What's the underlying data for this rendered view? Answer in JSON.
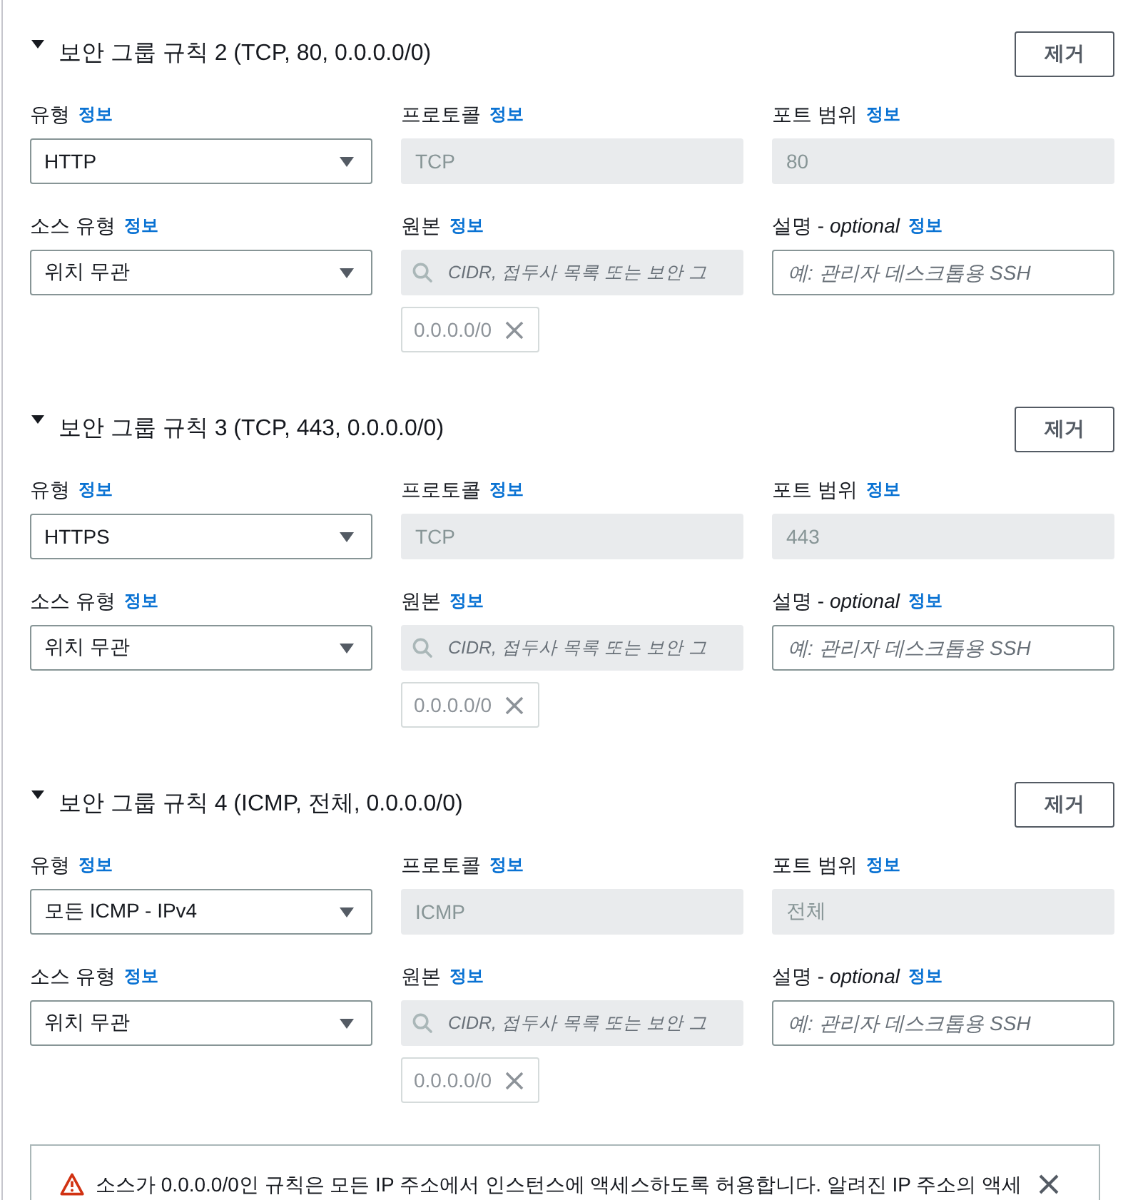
{
  "rules": [
    {
      "title": "보안 그룹 규칙 2 (TCP, 80, 0.0.0.0/0)",
      "expanded": true,
      "remove_button": "제거",
      "fields": [
        {
          "kind": "select",
          "label": "유형",
          "info": "정보",
          "value": "HTTP"
        },
        {
          "kind": "readonly",
          "label": "프로토콜",
          "info": "정보",
          "value": "TCP"
        },
        {
          "kind": "readonly",
          "label": "포트 범위",
          "info": "정보",
          "value": "80"
        },
        {
          "kind": "select",
          "label": "소스 유형",
          "info": "정보",
          "value": "위치 무관"
        },
        {
          "kind": "search",
          "label": "원본",
          "info": "정보",
          "placeholder": "CIDR, 접두사 목록 또는 보안 그",
          "disabled": true,
          "tokens": [
            "0.0.0.0/0"
          ]
        },
        {
          "kind": "text",
          "label": "설명 - *optional*",
          "info": "정보",
          "placeholder": "예: 관리자 데스크톱용 SSH"
        }
      ]
    },
    {
      "title": "보안 그룹 규칙 3 (TCP, 443, 0.0.0.0/0)",
      "expanded": true,
      "remove_button": "제거",
      "fields": [
        {
          "kind": "select",
          "label": "유형",
          "info": "정보",
          "value": "HTTPS"
        },
        {
          "kind": "readonly",
          "label": "프로토콜",
          "info": "정보",
          "value": "TCP"
        },
        {
          "kind": "readonly",
          "label": "포트 범위",
          "info": "정보",
          "value": "443"
        },
        {
          "kind": "select",
          "label": "소스 유형",
          "info": "정보",
          "value": "위치 무관"
        },
        {
          "kind": "search",
          "label": "원본",
          "info": "정보",
          "placeholder": "CIDR, 접두사 목록 또는 보안 그",
          "disabled": true,
          "tokens": [
            "0.0.0.0/0"
          ]
        },
        {
          "kind": "text",
          "label": "설명 - *optional*",
          "info": "정보",
          "placeholder": "예: 관리자 데스크톱용 SSH"
        }
      ]
    },
    {
      "title": "보안 그룹 규칙 4 (ICMP, 전체, 0.0.0.0/0)",
      "expanded": true,
      "remove_button": "제거",
      "fields": [
        {
          "kind": "select",
          "label": "유형",
          "info": "정보",
          "value": "모든 ICMP - IPv4"
        },
        {
          "kind": "readonly",
          "label": "프로토콜",
          "info": "정보",
          "value": "ICMP"
        },
        {
          "kind": "readonly",
          "label": "포트 범위",
          "info": "정보",
          "value": "전체"
        },
        {
          "kind": "select",
          "label": "소스 유형",
          "info": "정보",
          "value": "위치 무관"
        },
        {
          "kind": "search",
          "label": "원본",
          "info": "정보",
          "placeholder": "CIDR, 접두사 목록 또는 보안 그",
          "disabled": true,
          "tokens": [
            "0.0.0.0/0"
          ]
        },
        {
          "kind": "text",
          "label": "설명 - *optional*",
          "info": "정보",
          "placeholder": "예: 관리자 데스크톱용 SSH"
        }
      ]
    }
  ],
  "alert": {
    "text": "소스가 0.0.0.0/0인 규칙은 모든 IP 주소에서 인스턴스에 액세스하도록 허용합니다. 알려진 IP 주소의 액세"
  }
}
